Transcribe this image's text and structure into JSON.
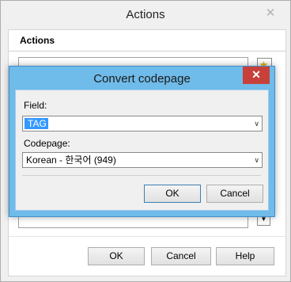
{
  "outer_window": {
    "title": "Actions",
    "close_glyph": "✕",
    "section_header": "Actions",
    "ok_label": "OK",
    "cancel_label": "Cancel",
    "help_label": "Help"
  },
  "dialog": {
    "title": "Convert codepage",
    "close_glyph": "✕",
    "field_label": "Field:",
    "field_value": "TAG",
    "codepage_label": "Codepage:",
    "codepage_value": "Korean - 한국어 (949)",
    "ok_label": "OK",
    "cancel_label": "Cancel"
  },
  "icons": {
    "dropdown_arrow": "∨",
    "star": "★"
  },
  "colors": {
    "dialog_frame": "#6fbbe9",
    "close_button": "#c7413a",
    "selection": "#3399ff"
  }
}
